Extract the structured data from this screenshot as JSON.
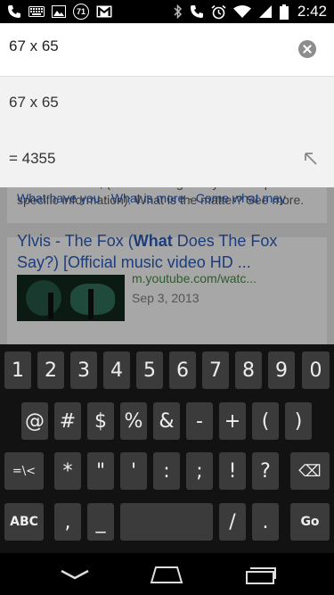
{
  "status_bar": {
    "left_icons": [
      "phone-icon",
      "keyboard-icon",
      "image-icon",
      "notification-count-icon",
      "gmail-icon"
    ],
    "badge_count": "71",
    "right_icons": [
      "bluetooth-icon",
      "phone-icon",
      "alarm-icon",
      "wifi-icon",
      "signal-icon",
      "battery-icon"
    ],
    "time": "2:42"
  },
  "search": {
    "query": "67 x 65",
    "clear_icon": "clear-icon"
  },
  "suggestions": [
    {
      "text": "67 x 65"
    },
    {
      "text": "= 4355",
      "icon": "refine-arrow-icon"
    }
  ],
  "results": {
    "snippet": "What definition, (used interrogatively as a request for specific information): What is the matter? See more.",
    "related_links": [
      "What have you",
      "What is more",
      "Come what may"
    ],
    "related_sep": "·",
    "video": {
      "title_pre": "Ylvis - The Fox (",
      "title_bold1": "What",
      "title_mid": " Does The Fox Say?) [Official music video HD ...",
      "url": "m.youtube.com/watc...",
      "date": "Sep 3, 2013"
    }
  },
  "keyboard": {
    "rows": [
      [
        "1",
        "2",
        "3",
        "4",
        "5",
        "6",
        "7",
        "8",
        "9",
        "0"
      ],
      [
        "@",
        "#",
        "$",
        "%",
        "&",
        "-",
        "+",
        "(",
        ")"
      ],
      [
        "=\\<",
        "*",
        "\"",
        "'",
        ":",
        ";",
        "!",
        "?",
        "⌫"
      ],
      [
        "ABC",
        ",",
        "_",
        " ",
        "/",
        ".",
        "Go"
      ]
    ]
  },
  "nav_bar": {
    "back_icon": "back-icon",
    "home_icon": "home-icon",
    "recents_icon": "recents-icon"
  }
}
